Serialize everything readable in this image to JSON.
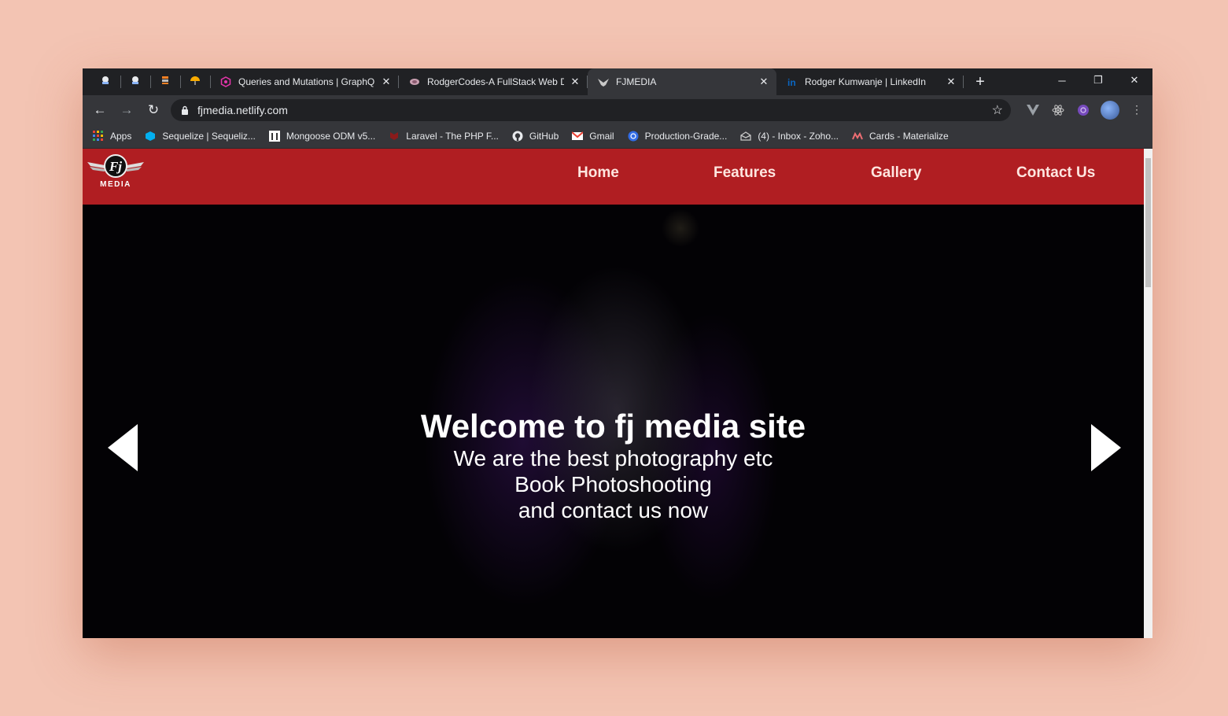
{
  "browser": {
    "tabs": [
      {
        "title": "Queries and Mutations | GraphQ",
        "icon": "graphql-icon"
      },
      {
        "title": "RodgerCodes-A FullStack Web D",
        "icon": "site-icon"
      },
      {
        "title": "FJMEDIA",
        "icon": "fj-logo-icon",
        "active": true
      },
      {
        "title": "Rodger Kumwanje | LinkedIn",
        "icon": "linkedin-icon"
      }
    ],
    "url": "fjmedia.netlify.com",
    "bookmarks": [
      {
        "label": "Apps",
        "icon": "apps-grid-icon"
      },
      {
        "label": "Sequelize | Sequeliz...",
        "icon": "sequelize-icon"
      },
      {
        "label": "Mongoose ODM v5...",
        "icon": "mongoose-icon"
      },
      {
        "label": "Laravel - The PHP F...",
        "icon": "laravel-icon"
      },
      {
        "label": "GitHub",
        "icon": "github-icon"
      },
      {
        "label": "Gmail",
        "icon": "gmail-icon"
      },
      {
        "label": "Production-Grade...",
        "icon": "kubernetes-icon"
      },
      {
        "label": "(4) - Inbox - Zoho...",
        "icon": "zoho-mail-icon"
      },
      {
        "label": "Cards - Materialize",
        "icon": "materialize-icon"
      }
    ]
  },
  "site": {
    "logo_text": "MEDIA",
    "logo_monogram": "Fj",
    "nav": {
      "home": "Home",
      "features": "Features",
      "gallery": "Gallery",
      "contact": "Contact Us"
    },
    "hero": {
      "title": "Welcome to fj media site",
      "line1": "We are the best photography etc",
      "line2": "Book Photoshooting",
      "line3": "and contact us now"
    }
  },
  "colors": {
    "page_background": "#f3c4b3",
    "navbar": "#b01e22",
    "browser_frame": "#202124",
    "browser_toolbar": "#35363a"
  }
}
